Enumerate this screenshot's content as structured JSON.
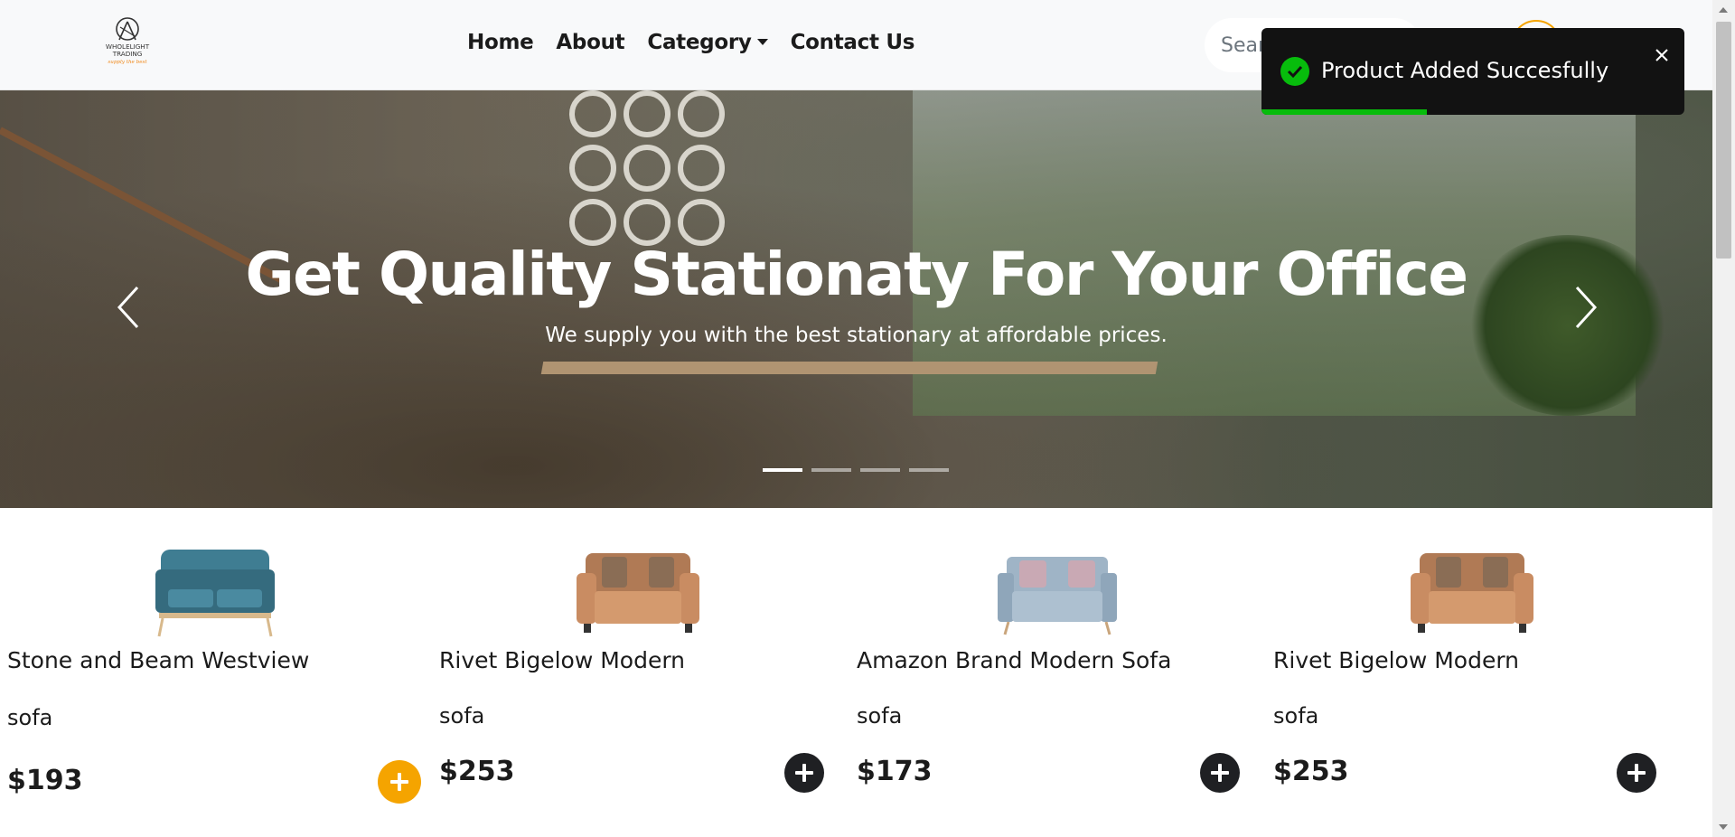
{
  "brand": {
    "logo_line1": "WHOLELIGHT",
    "logo_line2": "TRADING",
    "logo_tagline": "supply the best"
  },
  "nav": {
    "home": "Home",
    "about": "About",
    "category": "Category",
    "contact": "Contact Us",
    "search_placeholder": "Search"
  },
  "hero": {
    "title": "Get Quality Stationaty For Your Office",
    "subtitle": "We supply you with the best stationary at affordable prices.",
    "slide_count": 4,
    "active_slide": 1
  },
  "products": [
    {
      "name": "Stone and Beam Westview",
      "category": "sofa",
      "price": "$193",
      "color": "#3f7d92",
      "button_color": "#f5a400"
    },
    {
      "name": "Rivet Bigelow Modern",
      "category": "sofa",
      "price": "$253",
      "color": "#c98c62",
      "button_color": "#1f2023"
    },
    {
      "name": "Amazon Brand Modern Sofa",
      "category": "sofa",
      "price": "$173",
      "color": "#9fb4c6",
      "button_color": "#1f2023"
    },
    {
      "name": "Rivet Bigelow Modern",
      "category": "sofa",
      "price": "$253",
      "color": "#c98c62",
      "button_color": "#1f2023"
    }
  ],
  "toast": {
    "message": "Product Added Succesfully",
    "status": "success",
    "progress_percent": 39,
    "accent": "#07bc0c"
  },
  "colors": {
    "accent": "#f5a400",
    "dark": "#1f2023",
    "navbar_bg": "#f8f9fa"
  }
}
